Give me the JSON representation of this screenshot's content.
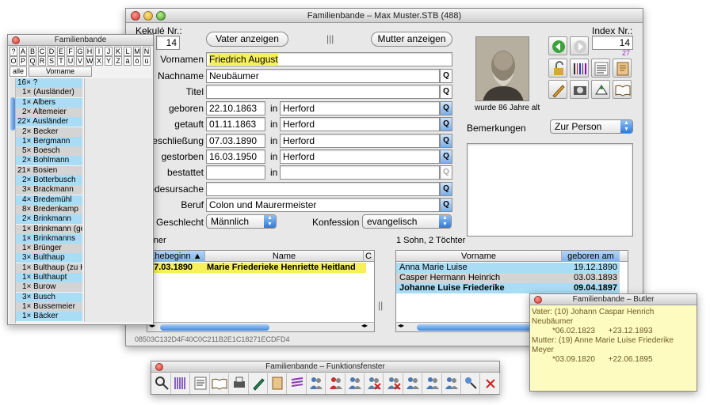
{
  "main_window": {
    "title": "Familienbande – Max Muster.STB  (488)",
    "kekule_label": "Kekulé Nr.:",
    "kekule_value": "14",
    "index_label": "Index Nr.:",
    "index_value": "14",
    "index_sub": "27",
    "vater_button": "Vater anzeigen",
    "mutter_button": "Mutter anzeigen",
    "fields": {
      "vornamen_label": "Vornamen",
      "vornamen_value": "Friedrich August",
      "nachname_label": "Nachname",
      "nachname_value": "Neubäumer",
      "titel_label": "Titel",
      "titel_value": "",
      "geboren_label": "geboren",
      "geboren_date": "22.10.1863",
      "geboren_place": "Herford",
      "getauft_label": "getauft",
      "getauft_date": "01.11.1863",
      "getauft_place": "Herford",
      "eheschl_label": "eschließung",
      "eheschl_date": "07.03.1890",
      "eheschl_place": "Herford",
      "gestorben_label": "gestorben",
      "gestorben_date": "16.03.1950",
      "gestorben_place": "Herford",
      "bestattet_label": "bestattet",
      "bestattet_date": "",
      "bestattet_place": "",
      "in_label": "in",
      "todesursache_label": "odesursache",
      "todesursache_value": "",
      "beruf_label": "Beruf",
      "beruf_value": "Colon und Maurermeister",
      "geschlecht_label": "Geschlecht",
      "geschlecht_value": "Männlich",
      "konfession_label": "Konfession",
      "konfession_value": "evangelisch",
      "q": "Q"
    },
    "photo_caption": "wurde 86 Jahre alt",
    "bemerkungen_label": "Bemerkungen",
    "bemerkungen_popup": "Zur Person",
    "partner_label": "rtner",
    "partner_table": {
      "col1": "Ehebeginn ▲",
      "col2": "Name",
      "col3": "C",
      "rows": [
        {
          "date": "07.03.1890",
          "name": "Marie Friederieke Henriette Heitland"
        }
      ]
    },
    "children_label": "1 Sohn, 2 Töchter",
    "children_table": {
      "col1": "Vorname",
      "col2": "geboren am",
      "rows": [
        {
          "name": "Anna Marie Luise",
          "date": "19.12.1890"
        },
        {
          "name": "Casper Hermann Heinrich",
          "date": "03.03.1893"
        },
        {
          "name": "Johanne Luise Friederike",
          "date": "09.04.1897"
        }
      ]
    },
    "hash": "08503C132D4F40C0C211B2E1C18271ECDFD4"
  },
  "name_window": {
    "title": "Familienbande",
    "letters_row1": [
      "?",
      "A",
      "B",
      "C",
      "D",
      "E",
      "F",
      "G",
      "H",
      "I",
      "J",
      "K",
      "L",
      "M",
      "N"
    ],
    "letters_row2": [
      "O",
      "P",
      "Q",
      "R",
      "S",
      "T",
      "U",
      "V",
      "W",
      "X",
      "Y",
      "Z",
      "ä",
      "ö",
      "ü"
    ],
    "alle": "alle",
    "vorname_col": "Vorname",
    "names": [
      {
        "t": "16× ?",
        "ind": 0,
        "c": "blue"
      },
      {
        "t": "1× (Ausländer)",
        "ind": 1,
        "c": "grey"
      },
      {
        "t": "1× Albers",
        "ind": 1,
        "c": "blue"
      },
      {
        "t": "2× Altemeier",
        "ind": 1,
        "c": "grey"
      },
      {
        "t": "22× Ausländer",
        "ind": 0,
        "c": "blue"
      },
      {
        "t": "2× Becker",
        "ind": 1,
        "c": "grey"
      },
      {
        "t": "1× Bergmann",
        "ind": 1,
        "c": "blue"
      },
      {
        "t": "5× Boesch",
        "ind": 1,
        "c": "grey"
      },
      {
        "t": "2× Bohlmann",
        "ind": 1,
        "c": "blue"
      },
      {
        "t": "21× Bosien",
        "ind": 0,
        "c": "grey"
      },
      {
        "t": "2× Botterbusch",
        "ind": 1,
        "c": "blue"
      },
      {
        "t": "3× Brackmann",
        "ind": 1,
        "c": "grey"
      },
      {
        "t": "4× Bredemühl",
        "ind": 1,
        "c": "blue"
      },
      {
        "t": "8× Bredenkamp",
        "ind": 1,
        "c": "grey"
      },
      {
        "t": "2× Brinkmann",
        "ind": 1,
        "c": "blue"
      },
      {
        "t": "1× Brinkmann (ge",
        "ind": 1,
        "c": "grey"
      },
      {
        "t": "1× Brinkmanns",
        "ind": 1,
        "c": "blue"
      },
      {
        "t": "1× Brünger",
        "ind": 1,
        "c": "grey"
      },
      {
        "t": "3× Bulthaup",
        "ind": 1,
        "c": "blue"
      },
      {
        "t": "1× Bulthaup (zu H",
        "ind": 1,
        "c": "grey"
      },
      {
        "t": "1× Bulthaupt",
        "ind": 1,
        "c": "blue"
      },
      {
        "t": "1× Burow",
        "ind": 1,
        "c": "grey"
      },
      {
        "t": "3× Busch",
        "ind": 1,
        "c": "blue"
      },
      {
        "t": "1× Bussemeier",
        "ind": 1,
        "c": "grey"
      },
      {
        "t": "1× Bäcker",
        "ind": 1,
        "c": "blue"
      }
    ]
  },
  "tools_window": {
    "title": "Familienbande – Funktionsfenster",
    "icons": [
      "magnifier-icon",
      "barcode-icon",
      "list-icon",
      "book-icon",
      "printer-icon",
      "pen-icon",
      "scroll-icon",
      "lines-icon",
      "people-blue-icon",
      "people-red-icon",
      "people-blue2-icon",
      "delete-people-icon",
      "delete-person-icon",
      "people-group-icon",
      "people-group2-icon",
      "people-group3-icon",
      "search-person-icon",
      "close-icon"
    ]
  },
  "butler_window": {
    "title": "Familienbande – Butler",
    "vater_line1": "Vater: (10) Johann Caspar Henrich",
    "vater_line2": "Neubäumer",
    "vater_dates": "*06.02.1823      +23.12.1893",
    "mutter_line1": "Mutter: (19) Anne Marie Luise Friederike",
    "mutter_line2": "Meyer",
    "mutter_dates": "*03.09.1820      +22.06.1895"
  },
  "colors": {
    "highlight_yellow": "#f7f05a",
    "row_blue": "#a9dcf5",
    "row_grey": "#d4d4d4",
    "butler_bg": "#fdfbbf"
  }
}
